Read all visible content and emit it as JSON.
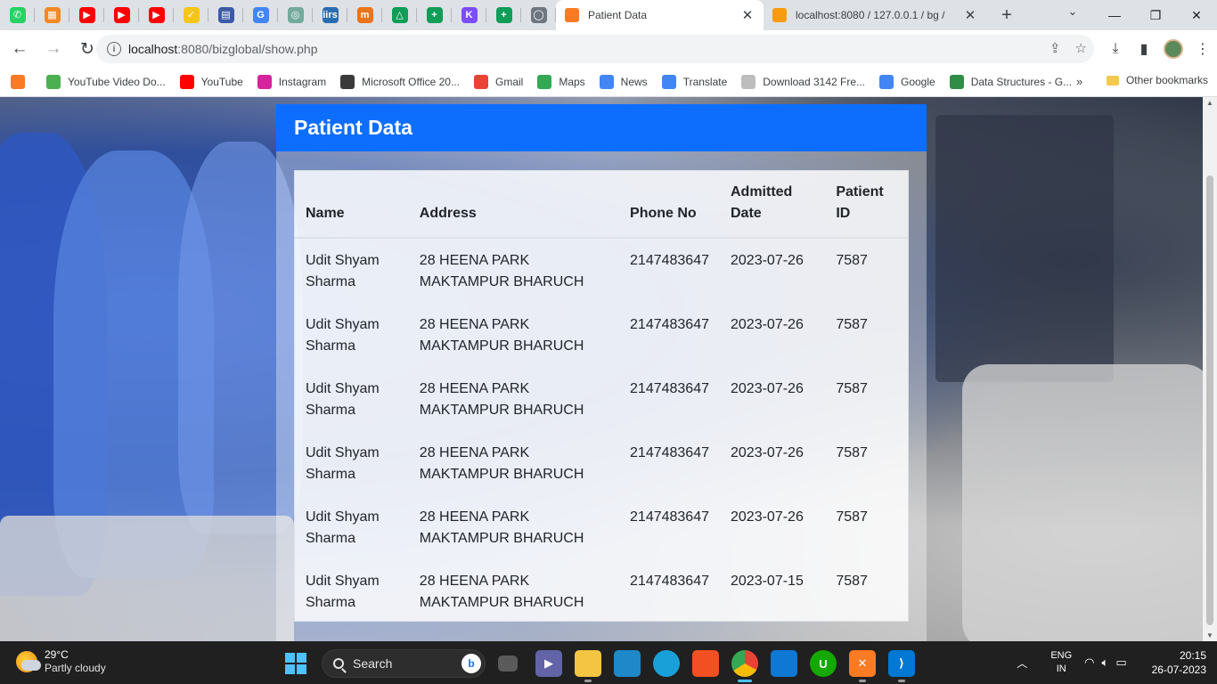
{
  "browser": {
    "pinned_tabs": [
      {
        "icon": "whatsapp-icon",
        "color": "#25d366",
        "glyph": "✆"
      },
      {
        "icon": "app-orange-icon",
        "color": "#f08a24",
        "glyph": "▦"
      },
      {
        "icon": "youtube-icon",
        "color": "#ff0000",
        "glyph": "▶"
      },
      {
        "icon": "youtube-icon",
        "color": "#ff0000",
        "glyph": "▶"
      },
      {
        "icon": "youtube-icon",
        "color": "#ff0000",
        "glyph": "▶"
      },
      {
        "icon": "checkmark-app-icon",
        "color": "#f5c518",
        "glyph": "✓"
      },
      {
        "icon": "calendar-app-icon",
        "color": "#3b5ba9",
        "glyph": "▤"
      },
      {
        "icon": "google-icon",
        "color": "#4285f4",
        "glyph": "G"
      },
      {
        "icon": "openai-icon",
        "color": "#74aa9c",
        "glyph": "◎"
      },
      {
        "icon": "iirs-icon",
        "color": "#2b6cb0",
        "glyph": "iirs"
      },
      {
        "icon": "app-m-icon",
        "color": "#e8741c",
        "glyph": "m"
      },
      {
        "icon": "google-drive-icon",
        "color": "#0f9d58",
        "glyph": "△"
      },
      {
        "icon": "google-sheets-icon",
        "color": "#0f9d58",
        "glyph": "+"
      },
      {
        "icon": "klipfolio-icon",
        "color": "#7c4dff",
        "glyph": "K"
      },
      {
        "icon": "google-classroom-icon",
        "color": "#0f9d58",
        "glyph": "+"
      },
      {
        "icon": "github-icon",
        "color": "#6e7681",
        "glyph": "◯"
      }
    ],
    "active_tab": {
      "title": "Patient Data",
      "favicon": "xampp-icon",
      "favicon_color": "#fb7a24"
    },
    "other_tab": {
      "title": "localhost:8080 / 127.0.0.1 / bg /",
      "favicon": "phpmyadmin-icon",
      "favicon_color": "#f89c0e"
    },
    "address": {
      "host": "localhost",
      "path": ":8080/bizglobal/show.php"
    }
  },
  "bookmarks": [
    {
      "label": "",
      "icon": "xampp-icon",
      "color": "#fb7a24"
    },
    {
      "label": "YouTube Video Do...",
      "icon": "download-arrow-icon",
      "color": "#4caf50"
    },
    {
      "label": "YouTube",
      "icon": "youtube-icon",
      "color": "#ff0000"
    },
    {
      "label": "Instagram",
      "icon": "instagram-icon",
      "color": "#d6249f"
    },
    {
      "label": "Microsoft Office 20...",
      "icon": "g-dark-icon",
      "color": "#3a3a3a"
    },
    {
      "label": "Gmail",
      "icon": "gmail-icon",
      "color": "#ea4335"
    },
    {
      "label": "Maps",
      "icon": "maps-pin-icon",
      "color": "#34a853"
    },
    {
      "label": "News",
      "icon": "google-news-icon",
      "color": "#4285f4"
    },
    {
      "label": "Translate",
      "icon": "google-translate-icon",
      "color": "#4285f4"
    },
    {
      "label": "Download 3142 Fre...",
      "icon": "image-icon",
      "color": "#bdbdbd"
    },
    {
      "label": "Google",
      "icon": "google-icon",
      "color": "#4285f4"
    },
    {
      "label": "Data Structures - G...",
      "icon": "geeksforgeeks-icon",
      "color": "#2f8d46"
    }
  ],
  "other_bookmarks": "Other bookmarks",
  "page": {
    "title": "Patient Data",
    "columns": [
      "Name",
      "Address",
      "Phone No",
      "Admitted Date",
      "Patient ID"
    ],
    "rows": [
      [
        "Udit Shyam Sharma",
        "28 HEENA PARK MAKTAMPUR BHARUCH",
        "2147483647",
        "2023-07-26",
        "7587"
      ],
      [
        "Udit Shyam Sharma",
        "28 HEENA PARK MAKTAMPUR BHARUCH",
        "2147483647",
        "2023-07-26",
        "7587"
      ],
      [
        "Udit Shyam Sharma",
        "28 HEENA PARK MAKTAMPUR BHARUCH",
        "2147483647",
        "2023-07-26",
        "7587"
      ],
      [
        "Udit Shyam Sharma",
        "28 HEENA PARK MAKTAMPUR BHARUCH",
        "2147483647",
        "2023-07-26",
        "7587"
      ],
      [
        "Udit Shyam Sharma",
        "28 HEENA PARK MAKTAMPUR BHARUCH",
        "2147483647",
        "2023-07-26",
        "7587"
      ],
      [
        "Udit Shyam Sharma",
        "28 HEENA PARK MAKTAMPUR BHARUCH",
        "2147483647",
        "2023-07-15",
        "7587"
      ]
    ],
    "accent_color": "#0d6efd"
  },
  "taskbar": {
    "weather_temp": "29°C",
    "weather_desc": "Partly cloudy",
    "search_label": "Search",
    "lang_1": "ENG",
    "lang_2": "IN",
    "time": "20:15",
    "date": "26-07-2023"
  }
}
